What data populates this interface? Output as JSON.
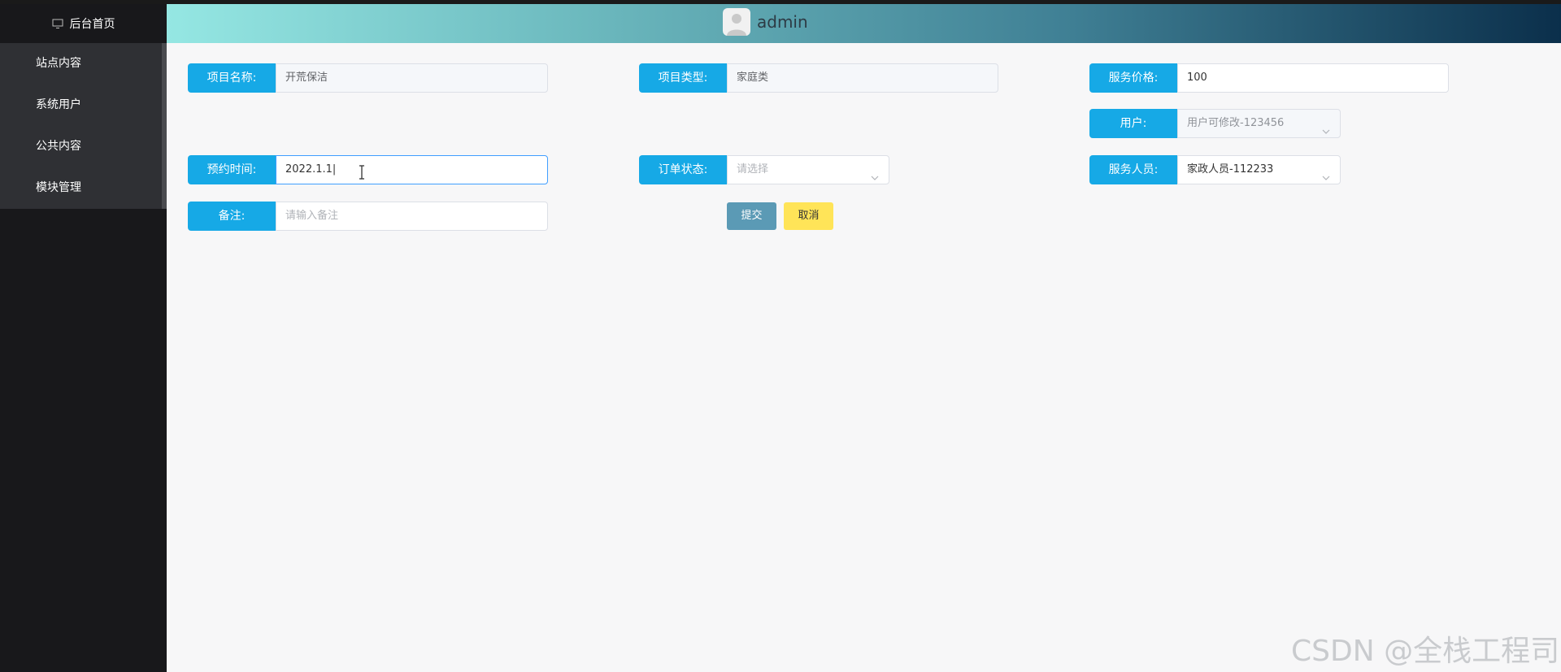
{
  "sidebar": {
    "home_label": "后台首页",
    "items": [
      {
        "label": "站点内容"
      },
      {
        "label": "系统用户"
      },
      {
        "label": "公共内容"
      },
      {
        "label": "模块管理"
      }
    ]
  },
  "header": {
    "username": "admin",
    "avatar_icon": "user-avatar-icon"
  },
  "form": {
    "project_name": {
      "label": "项目名称:",
      "value": "开荒保洁"
    },
    "project_type": {
      "label": "项目类型:",
      "value": "家庭类"
    },
    "service_price": {
      "label": "服务价格:",
      "value": "100"
    },
    "user": {
      "label": "用户:",
      "value": "用户可修改-123456"
    },
    "appointment_time": {
      "label": "预约时间:",
      "value": "2022.1.1|"
    },
    "order_status": {
      "label": "订单状态:",
      "placeholder": "请选择"
    },
    "service_staff": {
      "label": "服务人员:",
      "value": "家政人员-112233"
    },
    "remark": {
      "label": "备注:",
      "placeholder": "请输入备注"
    },
    "submit_label": "提交",
    "cancel_label": "取消"
  },
  "watermark": "CSDN @全栈工程司",
  "colors": {
    "label_bg": "#16a9e6",
    "sidebar_bg": "#18181b",
    "menu_bg": "#2f3034",
    "submit_bg": "#5b9ab5",
    "cancel_bg": "#ffe458"
  }
}
